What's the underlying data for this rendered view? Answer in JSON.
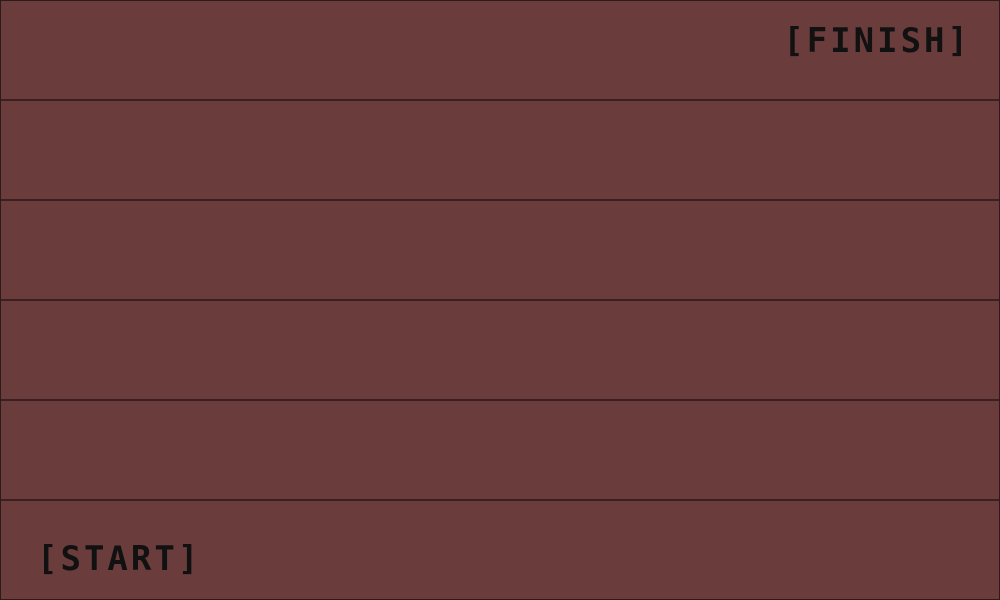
{
  "labels": {
    "finish": "[FINISH]",
    "start": "[START]"
  },
  "colors": {
    "background": "#6a3c3c",
    "lane_line": "#3a2020",
    "text": "#111111"
  },
  "lane_count": 6
}
